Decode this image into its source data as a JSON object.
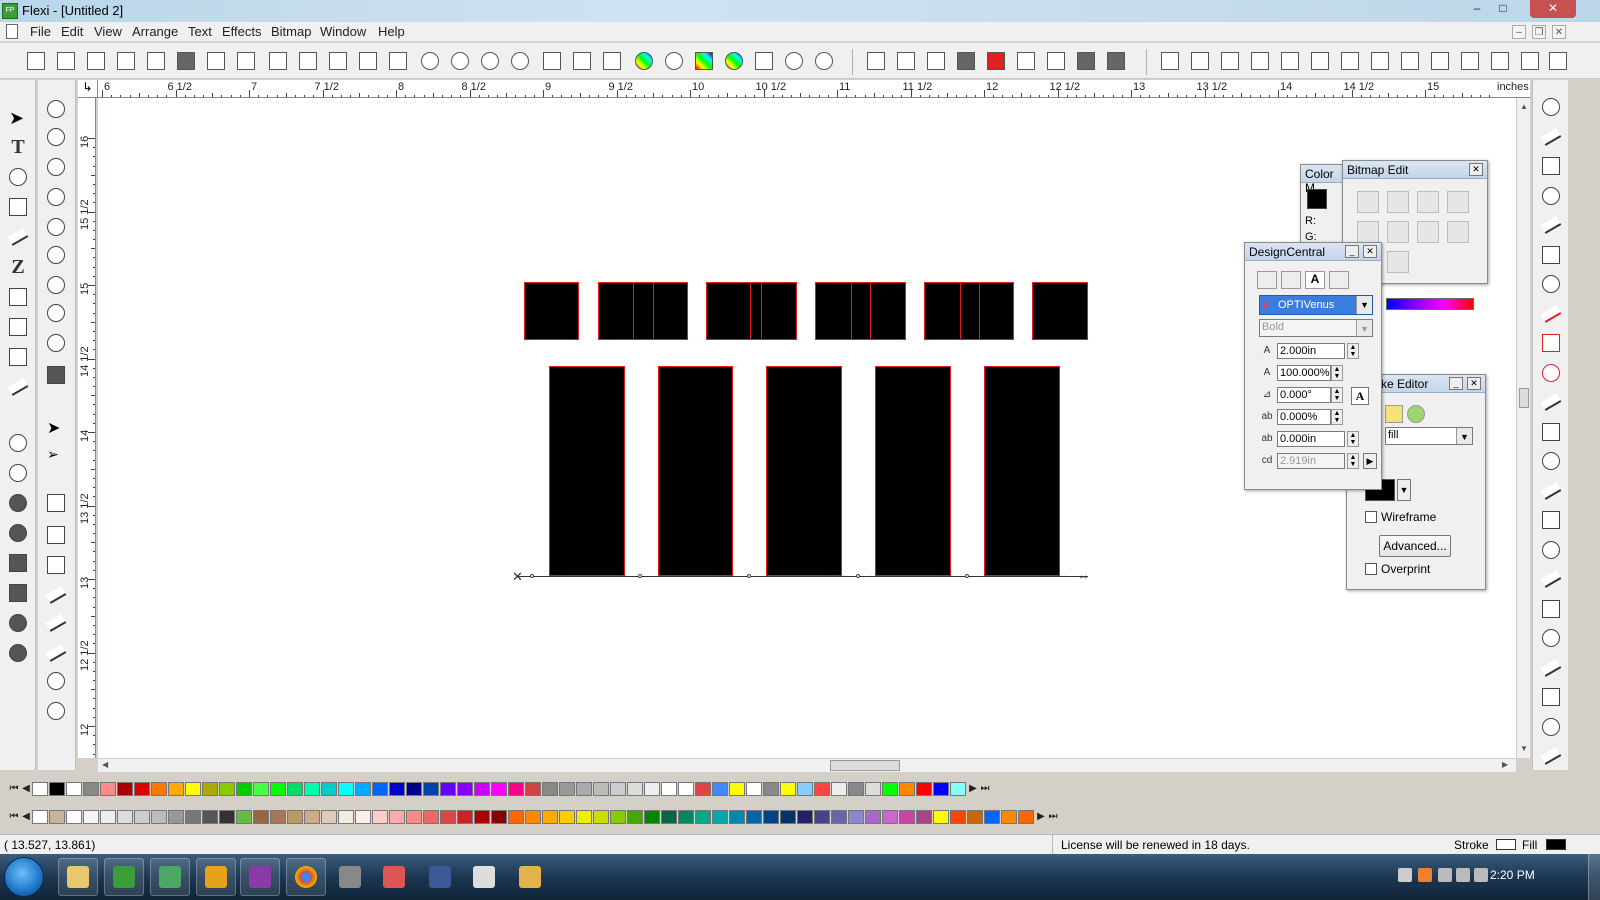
{
  "window": {
    "title": "Flexi - [Untitled 2]",
    "controls": {
      "minimize": "–",
      "maximize": "□",
      "close": "✕"
    }
  },
  "menu": [
    "File",
    "Edit",
    "View",
    "Arrange",
    "Text",
    "Effects",
    "Bitmap",
    "Window",
    "Help"
  ],
  "ruler": {
    "unit": "inches",
    "h_labels": [
      "6",
      "6 1/2",
      "7",
      "7 1/2",
      "8",
      "8 1/2",
      "9",
      "9 1/2",
      "10",
      "10 1/2",
      "11",
      "11 1/2",
      "12",
      "12 1/2",
      "13",
      "13 1/2",
      "14",
      "14 1/2",
      "15"
    ],
    "v_labels": [
      "16",
      "15 1/2",
      "15",
      "14 1/2",
      "14",
      "13 1/2",
      "13",
      "12 1/2",
      "12"
    ]
  },
  "panels": {
    "color_panel": {
      "title": "Color M",
      "r_label": "R:",
      "g_label": "G:"
    },
    "bitmap_edit": {
      "title": "Bitmap Edit"
    },
    "design_central": {
      "title": "DesignCentral",
      "font": "OPTIVenus",
      "style": "Bold",
      "height": "2.000in",
      "width_pct": "100.000%",
      "slant": "0.000°",
      "char_spacing": "0.000%",
      "baseline_shift": "0.000in",
      "text_width": "2.919in"
    },
    "stroke_editor": {
      "title": "ke Editor",
      "fill_mode": "fill",
      "wireframe_label": "Wireframe",
      "advanced_label": "Advanced...",
      "overprint_label": "Overprint"
    }
  },
  "status": {
    "coords": "(   13.527,     13.861)",
    "license": "License will be renewed in 18 days.",
    "stroke_label": "Stroke",
    "fill_label": "Fill"
  },
  "taskbar": {
    "time": "2:20 PM"
  },
  "colors": {
    "shape_fill": "#000000",
    "shape_outline": "#e01b1b",
    "font_select_bg": "#3b7ddd"
  }
}
